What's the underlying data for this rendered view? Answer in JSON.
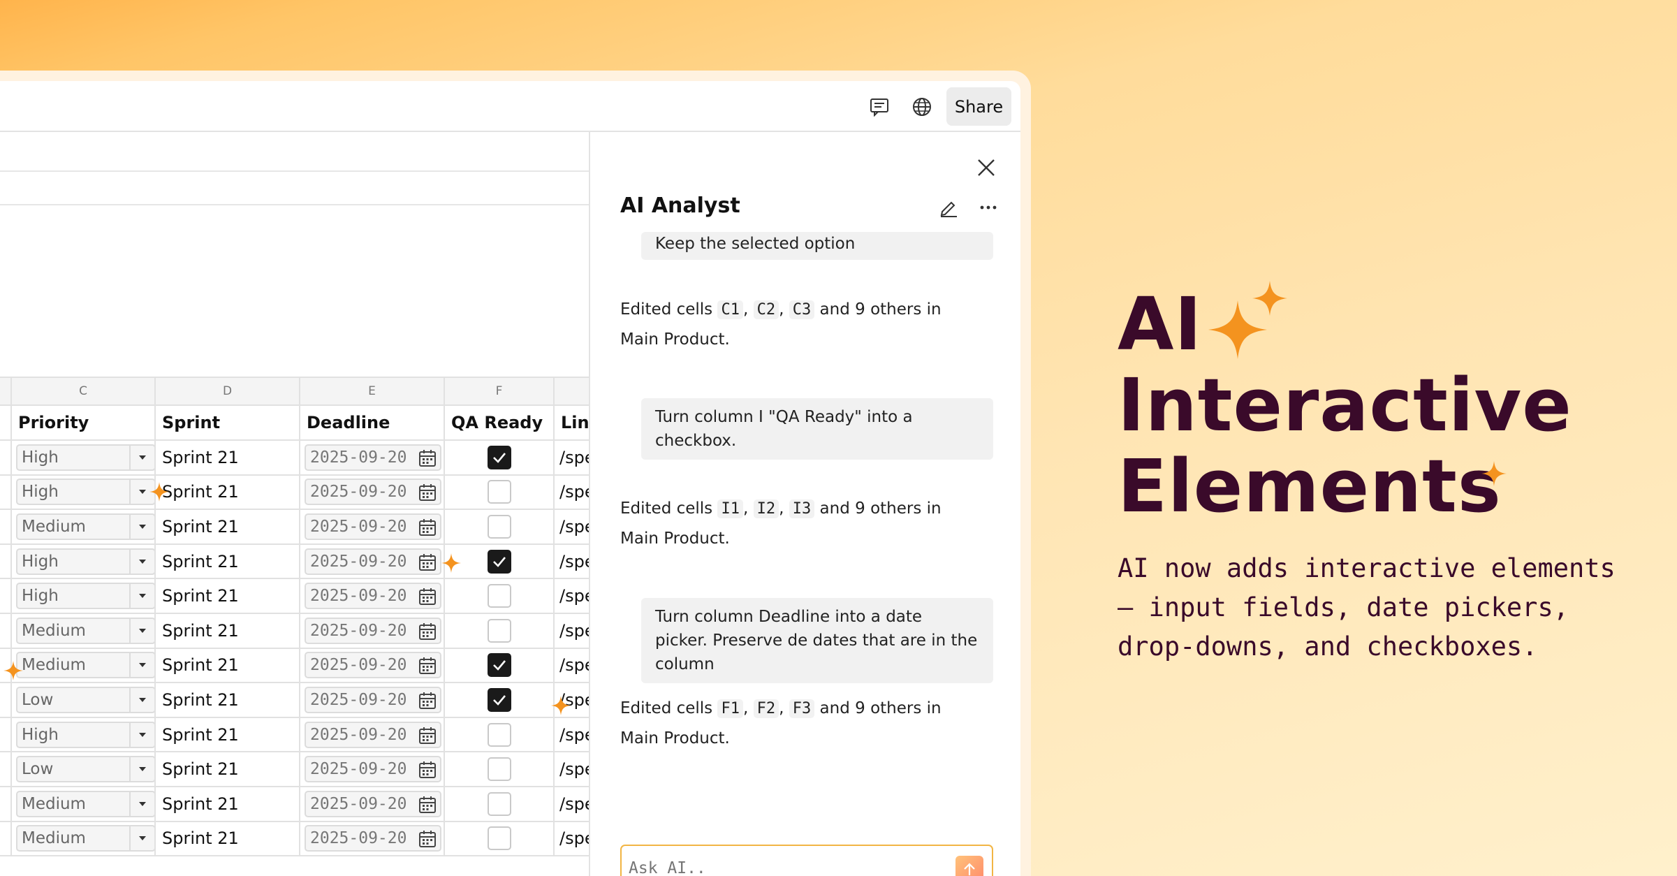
{
  "topbar": {
    "comment_icon": "comment-icon",
    "globe_icon": "globe-icon",
    "share_label": "Share"
  },
  "sheet": {
    "column_letters": [
      "C",
      "D",
      "E",
      "F",
      ""
    ],
    "headers": [
      "Priority",
      "Sprint",
      "Deadline",
      "QA Ready",
      "Link"
    ],
    "rows": [
      {
        "priority": "High",
        "sprint": "Sprint 21",
        "deadline": "2025-09-20",
        "qa_ready": true,
        "link": "/spe"
      },
      {
        "priority": "High",
        "sprint": "Sprint 21",
        "deadline": "2025-09-20",
        "qa_ready": false,
        "link": "/spe"
      },
      {
        "priority": "Medium",
        "sprint": "Sprint 21",
        "deadline": "2025-09-20",
        "qa_ready": false,
        "link": "/spe"
      },
      {
        "priority": "High",
        "sprint": "Sprint 21",
        "deadline": "2025-09-20",
        "qa_ready": true,
        "link": "/spe"
      },
      {
        "priority": "High",
        "sprint": "Sprint 21",
        "deadline": "2025-09-20",
        "qa_ready": false,
        "link": "/spe"
      },
      {
        "priority": "Medium",
        "sprint": "Sprint 21",
        "deadline": "2025-09-20",
        "qa_ready": false,
        "link": "/spe"
      },
      {
        "priority": "Medium",
        "sprint": "Sprint 21",
        "deadline": "2025-09-20",
        "qa_ready": true,
        "link": "/spe"
      },
      {
        "priority": "Low",
        "sprint": "Sprint 21",
        "deadline": "2025-09-20",
        "qa_ready": true,
        "link": "/spe"
      },
      {
        "priority": "High",
        "sprint": "Sprint 21",
        "deadline": "2025-09-20",
        "qa_ready": false,
        "link": "/spe"
      },
      {
        "priority": "Low",
        "sprint": "Sprint 21",
        "deadline": "2025-09-20",
        "qa_ready": false,
        "link": "/spe"
      },
      {
        "priority": "Medium",
        "sprint": "Sprint 21",
        "deadline": "2025-09-20",
        "qa_ready": false,
        "link": "/spe"
      },
      {
        "priority": "Medium",
        "sprint": "Sprint 21",
        "deadline": "2025-09-20",
        "qa_ready": false,
        "link": "/spe"
      }
    ]
  },
  "ai_panel": {
    "title": "AI Analyst",
    "prev_bubble": "Keep the selected option",
    "messages": [
      {
        "prefix": "Edited cells",
        "cells": [
          "C1",
          "C2",
          "C3"
        ],
        "suffix_line1": "and 9 others in",
        "suffix_line2": "Main Product."
      },
      {
        "prefix": "Edited cells",
        "cells": [
          "I1",
          "I2",
          "I3"
        ],
        "suffix_line1": "and 9 others in",
        "suffix_line2": "Main Product."
      },
      {
        "prefix": "Edited cells",
        "cells": [
          "F1",
          "F2",
          "F3"
        ],
        "suffix_line1": "and 9 others in",
        "suffix_line2": "Main Product."
      }
    ],
    "bubbles": [
      "Turn column I \"QA Ready\" into a checkbox.",
      "Turn column Deadline into a date picker. Preserve de dates that are in the column"
    ],
    "input_placeholder": "Ask AI.."
  },
  "hero": {
    "line1": "AI",
    "line2": "Interactive",
    "line3": "Elements",
    "subtitle": "AI now adds interactive elements – input fields, date pickers, drop-downs, and checkboxes."
  },
  "colors": {
    "accent_orange": "#f4931f",
    "hero_text": "#3a0a2a",
    "input_border": "#f2b544"
  }
}
